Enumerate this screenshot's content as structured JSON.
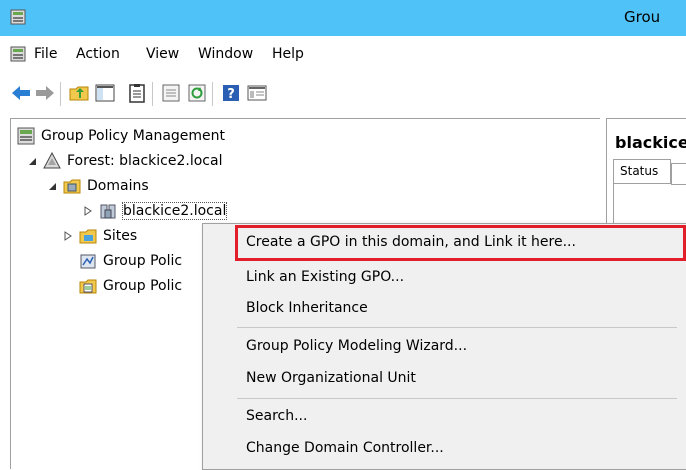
{
  "window": {
    "title": "Grou",
    "icon": "group-policy-icon"
  },
  "menu": [
    "File",
    "Action",
    "View",
    "Window",
    "Help"
  ],
  "toolbar": [
    "back-arrow-icon",
    "forward-arrow-icon",
    "folder-up-icon",
    "show-hide-tree-icon",
    "clipboard-icon",
    "properties-icon",
    "refresh-icon",
    "help-icon",
    "console-icon"
  ],
  "tree": {
    "root": "Group Policy Management",
    "forest": "Forest: blackice2.local",
    "domains": "Domains",
    "domain": "blackice2.local",
    "sites": "Sites",
    "modeling": "Group Polic",
    "results": "Group Polic"
  },
  "right_pane": {
    "header": "blackice",
    "tab_status": "Status"
  },
  "context_menu": {
    "items": [
      "Create a GPO in this domain, and Link it here...",
      "Link an Existing GPO...",
      "Block Inheritance",
      "Group Policy Modeling Wizard...",
      "New Organizational Unit",
      "Search...",
      "Change Domain Controller..."
    ]
  },
  "colors": {
    "titlebar": "#4fc3f7",
    "highlight_border": "#e21e2a",
    "menu_bg": "#f0f0f0"
  }
}
